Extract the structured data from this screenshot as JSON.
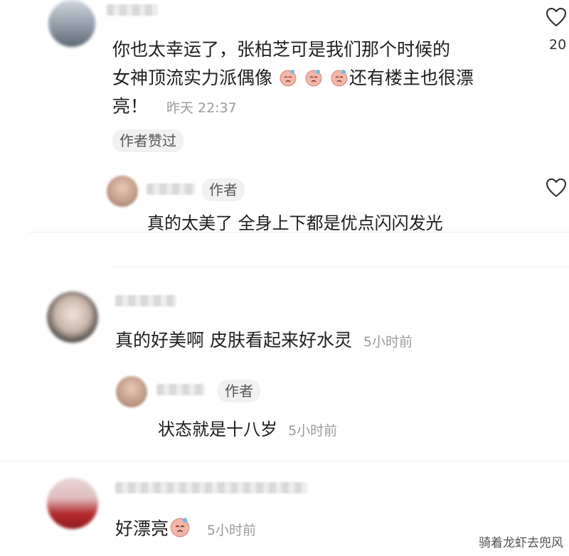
{
  "comment1": {
    "text_line1": "你也太幸运了，张柏芝可是我们那个时候的",
    "text_line2_prefix": "女神顶流实力派偶像",
    "text_line2_suffix": "还有楼主也很漂",
    "text_line3": "亮！",
    "time": "昨天 22:37",
    "like_count": "20",
    "liked_by_author": "作者赞过",
    "emoji_name": "crying-face-emoji"
  },
  "reply1": {
    "author_tag": "作者",
    "text": "真的太美了 全身上下都是优点闪闪发光"
  },
  "comment2": {
    "text": "真的好美啊 皮肤看起来好水灵",
    "time": "5小时前"
  },
  "reply2": {
    "author_tag": "作者",
    "text": "状态就是十八岁",
    "time": "5小时前"
  },
  "comment3": {
    "text": "好漂亮",
    "time": "5小时前"
  },
  "watermark": "骑着龙虾去兜风",
  "colors": {
    "meta": "#9a9a9a",
    "tag_bg": "#f1f1f1",
    "text": "#1c1c1c"
  }
}
